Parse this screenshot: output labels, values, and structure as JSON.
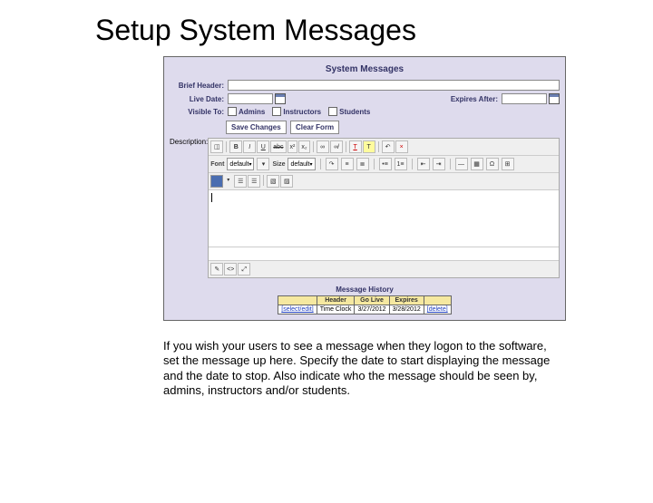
{
  "slide": {
    "title": "Setup System Messages",
    "explanation": "If you wish your users to see a message when they logon to the software, set the message up here. Specify the date to start displaying the message and the date to stop.  Also indicate who the message should be seen by, admins, instructors and/or students."
  },
  "panel": {
    "header": "System Messages",
    "labels": {
      "brief_header": "Brief Header:",
      "live_date": "Live Date:",
      "expires_after": "Expires After:",
      "visible_to": "Visible To:",
      "description": "Description:"
    },
    "visible_to": {
      "admins": "Admins",
      "instructors": "Instructors",
      "students": "Students"
    },
    "buttons": {
      "save": "Save Changes",
      "clear": "Clear Form"
    },
    "rte": {
      "font_label": "Font",
      "font_value": "default",
      "size_label": "Size",
      "size_value": "default",
      "bold": "B",
      "italic": "I",
      "underline": "U",
      "strike": "abc",
      "sup": "x²",
      "sub": "x₂",
      "link": "∞",
      "unlink": "∞̸",
      "color_t": "T",
      "fill_t": "T",
      "clear_fmt": "×",
      "undo": "↶",
      "redo": "↷",
      "align_l": "≡",
      "align_c": "≣",
      "align_r": "≡",
      "bullet": "•≡",
      "numbered": "1≡",
      "outdent": "⇤",
      "indent": "⇥",
      "hr": "—",
      "img": "▦",
      "symbol": "Ω",
      "table": "⊞",
      "body_cursor": "|"
    },
    "history": {
      "title": "Message History",
      "cols": {
        "header": "Header",
        "go_live": "Go Live",
        "expires": "Expires",
        "blank": ""
      },
      "row": {
        "select_edit": "[select/edit]",
        "header_val": "Time Clock",
        "go_live_val": "3/27/2012",
        "expires_val": "3/28/2012",
        "delete": "[delete]"
      }
    }
  }
}
